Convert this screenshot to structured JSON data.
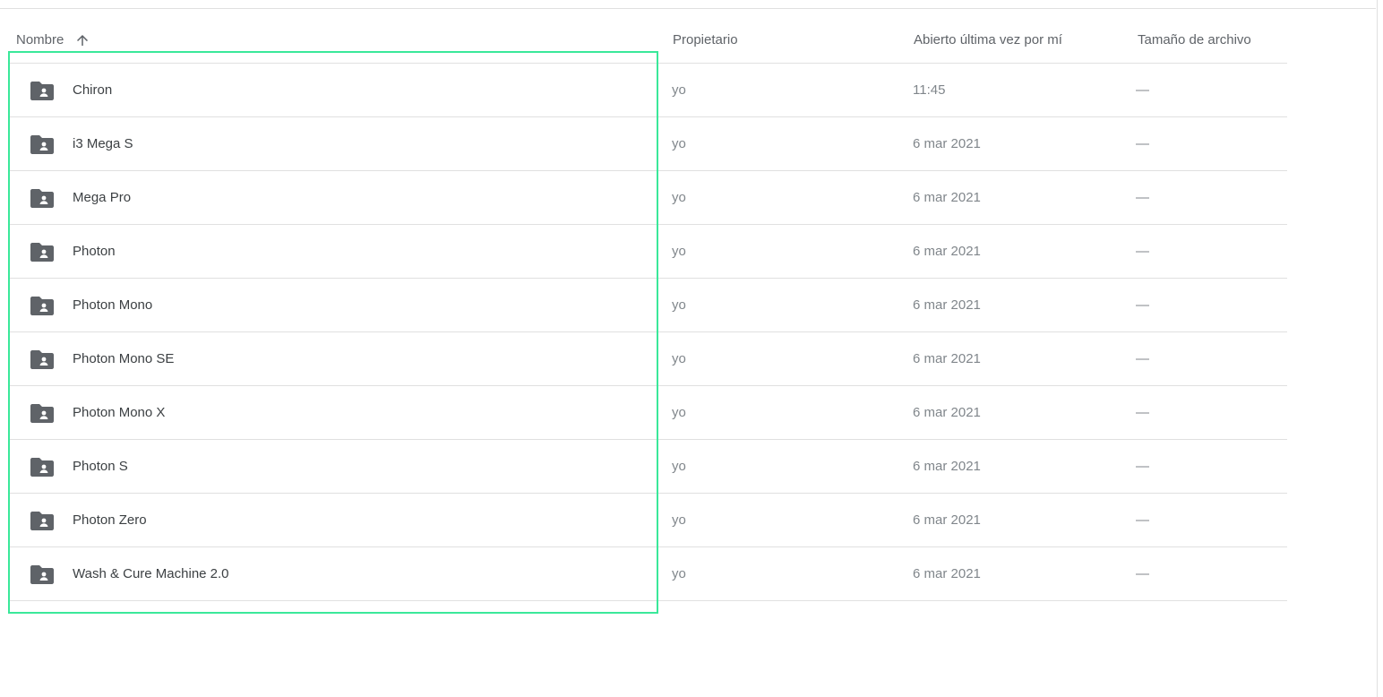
{
  "columns": {
    "name": "Nombre",
    "owner": "Propietario",
    "opened": "Abierto última vez por mí",
    "size": "Tamaño de archivo"
  },
  "sort": {
    "column": "name",
    "direction": "ascending",
    "icon": "arrow-up-icon"
  },
  "folder_icon": "shared-folder-icon",
  "selection_color": "#3ae89a",
  "rows": [
    {
      "name": "Chiron",
      "owner": "yo",
      "opened": "11:45",
      "size": "—"
    },
    {
      "name": "i3 Mega S",
      "owner": "yo",
      "opened": "6 mar 2021",
      "size": "—"
    },
    {
      "name": "Mega Pro",
      "owner": "yo",
      "opened": "6 mar 2021",
      "size": "—"
    },
    {
      "name": "Photon",
      "owner": "yo",
      "opened": "6 mar 2021",
      "size": "—"
    },
    {
      "name": "Photon Mono",
      "owner": "yo",
      "opened": "6 mar 2021",
      "size": "—"
    },
    {
      "name": "Photon Mono SE",
      "owner": "yo",
      "opened": "6 mar 2021",
      "size": "—"
    },
    {
      "name": "Photon Mono X",
      "owner": "yo",
      "opened": "6 mar 2021",
      "size": "—"
    },
    {
      "name": "Photon S",
      "owner": "yo",
      "opened": "6 mar 2021",
      "size": "—"
    },
    {
      "name": "Photon Zero",
      "owner": "yo",
      "opened": "6 mar 2021",
      "size": "—"
    },
    {
      "name": "Wash & Cure Machine 2.0",
      "owner": "yo",
      "opened": "6 mar 2021",
      "size": "—"
    }
  ]
}
